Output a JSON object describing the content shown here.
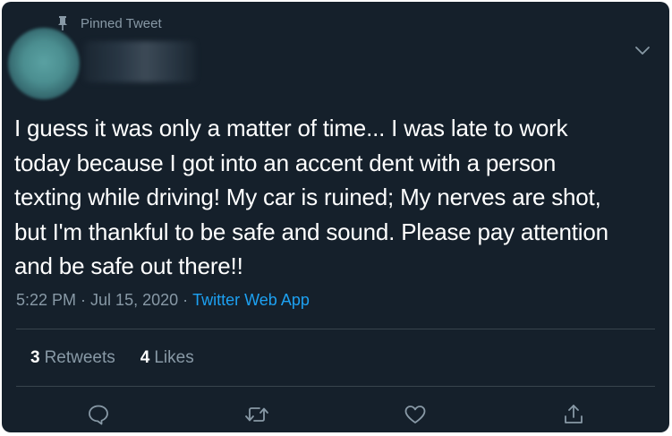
{
  "pinned": {
    "label": "Pinned Tweet",
    "icon": "pin-icon"
  },
  "author": {
    "avatar": "avatar",
    "name_blurred": ""
  },
  "tweet": {
    "text": "I guess it was only a matter of time... I was late to work\ntoday because I got into an accent dent with a person\ntexting while driving!  My car is ruined; My nerves are shot,\nbut I'm thankful to be safe and sound.  Please pay attention\nand be safe out there!!",
    "time": "5:22 PM",
    "separator": "·",
    "date": "Jul 15, 2020",
    "source": "Twitter Web App"
  },
  "stats": {
    "retweets_count": "3",
    "retweets_label": "Retweets",
    "likes_count": "4",
    "likes_label": "Likes"
  },
  "actions": {
    "reply": "reply-icon",
    "retweet": "retweet-icon",
    "like": "heart-icon",
    "share": "share-icon"
  },
  "colors": {
    "background": "#15202b",
    "text": "#ffffff",
    "secondary": "#8899a6",
    "link": "#1da1f2",
    "divider": "#38444d"
  }
}
